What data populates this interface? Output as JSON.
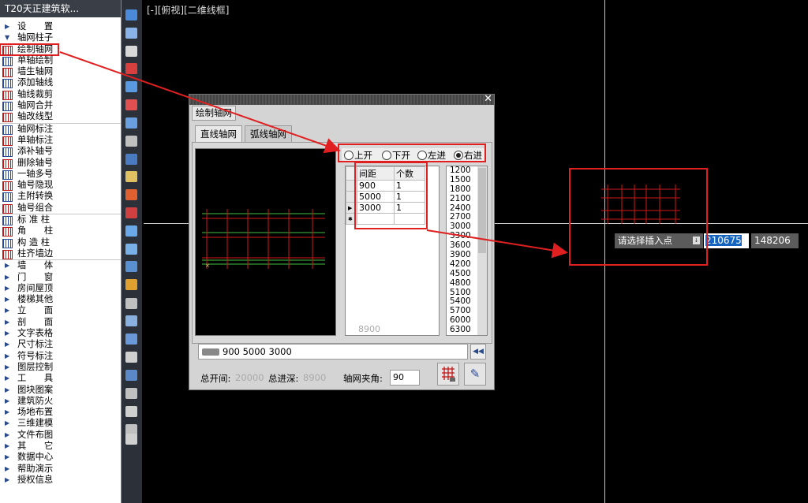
{
  "left_panel": {
    "title": "T20天正建筑软...",
    "items": [
      {
        "label": "设　　置",
        "icon": "expand-arrow-icon",
        "type": "arrow"
      },
      {
        "label": "轴网柱子",
        "icon": "collapse-arrow-icon",
        "type": "arrow"
      },
      {
        "label": "绘制轴网",
        "icon": "grid-draw-icon",
        "type": "icon",
        "highlight": true
      },
      {
        "label": "单轴绘制",
        "icon": "single-axis-icon",
        "type": "icon"
      },
      {
        "label": "墙生轴网",
        "icon": "wall-axis-icon",
        "type": "icon"
      },
      {
        "label": "添加轴线",
        "icon": "add-axis-icon",
        "type": "icon"
      },
      {
        "label": "轴线裁剪",
        "icon": "trim-axis-icon",
        "type": "icon"
      },
      {
        "label": "轴网合并",
        "icon": "merge-grid-icon",
        "type": "icon"
      },
      {
        "label": "轴改线型",
        "icon": "linetype-icon",
        "type": "icon"
      },
      {
        "label": "轴网标注",
        "icon": "grid-dim-icon",
        "type": "icon",
        "sep": true
      },
      {
        "label": "单轴标注",
        "icon": "single-dim-icon",
        "type": "icon"
      },
      {
        "label": "添补轴号",
        "icon": "add-number-icon",
        "type": "icon"
      },
      {
        "label": "删除轴号",
        "icon": "delete-number-icon",
        "type": "icon"
      },
      {
        "label": "一轴多号",
        "icon": "multi-number-icon",
        "type": "icon"
      },
      {
        "label": "轴号隐现",
        "icon": "toggle-number-icon",
        "type": "icon"
      },
      {
        "label": "主附转换",
        "icon": "convert-icon",
        "type": "icon"
      },
      {
        "label": "轴号组合",
        "icon": "combine-number-icon",
        "type": "icon"
      },
      {
        "label": "标 准 柱",
        "icon": "std-column-icon",
        "type": "icon",
        "sep": true
      },
      {
        "label": "角　　柱",
        "icon": "corner-column-icon",
        "type": "icon"
      },
      {
        "label": "构 造 柱",
        "icon": "struct-column-icon",
        "type": "icon"
      },
      {
        "label": "柱齐墙边",
        "icon": "align-column-icon",
        "type": "icon"
      },
      {
        "label": "墙　　体",
        "icon": "expand-arrow-icon",
        "type": "arrow",
        "sep": true
      },
      {
        "label": "门　　窗",
        "icon": "expand-arrow-icon",
        "type": "arrow"
      },
      {
        "label": "房间屋顶",
        "icon": "expand-arrow-icon",
        "type": "arrow"
      },
      {
        "label": "楼梯其他",
        "icon": "expand-arrow-icon",
        "type": "arrow"
      },
      {
        "label": "立　　面",
        "icon": "expand-arrow-icon",
        "type": "arrow"
      },
      {
        "label": "剖　　面",
        "icon": "expand-arrow-icon",
        "type": "arrow"
      },
      {
        "label": "文字表格",
        "icon": "expand-arrow-icon",
        "type": "arrow"
      },
      {
        "label": "尺寸标注",
        "icon": "expand-arrow-icon",
        "type": "arrow"
      },
      {
        "label": "符号标注",
        "icon": "expand-arrow-icon",
        "type": "arrow"
      },
      {
        "label": "图层控制",
        "icon": "expand-arrow-icon",
        "type": "arrow"
      },
      {
        "label": "工　　具",
        "icon": "expand-arrow-icon",
        "type": "arrow"
      },
      {
        "label": "图块图案",
        "icon": "expand-arrow-icon",
        "type": "arrow"
      },
      {
        "label": "建筑防火",
        "icon": "expand-arrow-icon",
        "type": "arrow"
      },
      {
        "label": "场地布置",
        "icon": "expand-arrow-icon",
        "type": "arrow"
      },
      {
        "label": "三维建模",
        "icon": "expand-arrow-icon",
        "type": "arrow"
      },
      {
        "label": "文件布图",
        "icon": "expand-arrow-icon",
        "type": "arrow"
      },
      {
        "label": "其　　它",
        "icon": "expand-arrow-icon",
        "type": "arrow"
      },
      {
        "label": "数据中心",
        "icon": "expand-arrow-icon",
        "type": "arrow"
      },
      {
        "label": "帮助演示",
        "icon": "expand-arrow-icon",
        "type": "arrow"
      },
      {
        "label": "授权信息",
        "icon": "expand-arrow-icon",
        "type": "arrow"
      }
    ]
  },
  "viewport": {
    "label": "[-][俯视][二维线框]"
  },
  "dialog": {
    "caption": "绘制轴网",
    "close_glyph": "✕",
    "tabs": [
      {
        "label": "直线轴网",
        "active": true
      },
      {
        "label": "弧线轴网",
        "active": false
      }
    ],
    "radios": [
      {
        "label": "上开",
        "checked": false
      },
      {
        "label": "下开",
        "checked": false
      },
      {
        "label": "左进",
        "checked": false
      },
      {
        "label": "右进",
        "checked": true
      }
    ],
    "table": {
      "headers": [
        "间距",
        "个数"
      ],
      "rows": [
        {
          "spacing": "900",
          "count": "1"
        },
        {
          "spacing": "5000",
          "count": "1"
        },
        {
          "spacing": "3000",
          "count": "1"
        }
      ],
      "current_row_marker": "▶",
      "new_row_marker": "✱"
    },
    "table_sum": "8900",
    "value_list": [
      "1200",
      "1500",
      "1800",
      "2100",
      "2400",
      "2700",
      "3000",
      "3300",
      "3600",
      "3900",
      "4200",
      "4500",
      "4800",
      "5100",
      "5400",
      "5700",
      "6000",
      "6300"
    ],
    "command_text": "900  5000  3000",
    "collapse_glyph": "◀◀",
    "total_width_label": "总开间:",
    "total_width_value": "20000",
    "total_depth_label": "总进深:",
    "total_depth_value": "8900",
    "angle_label": "轴网夹角:",
    "angle_value": "90",
    "pick_glyph": "✎"
  },
  "cursor_preview": {
    "prompt": "请选择插入点",
    "dropdown_glyph": "↓",
    "x_value": "210675",
    "y_value": "148206"
  },
  "colors": {
    "annotation": "#e02020",
    "grid_red": "#d01818",
    "grid_green": "#40c040",
    "selection": "#1565c0"
  }
}
